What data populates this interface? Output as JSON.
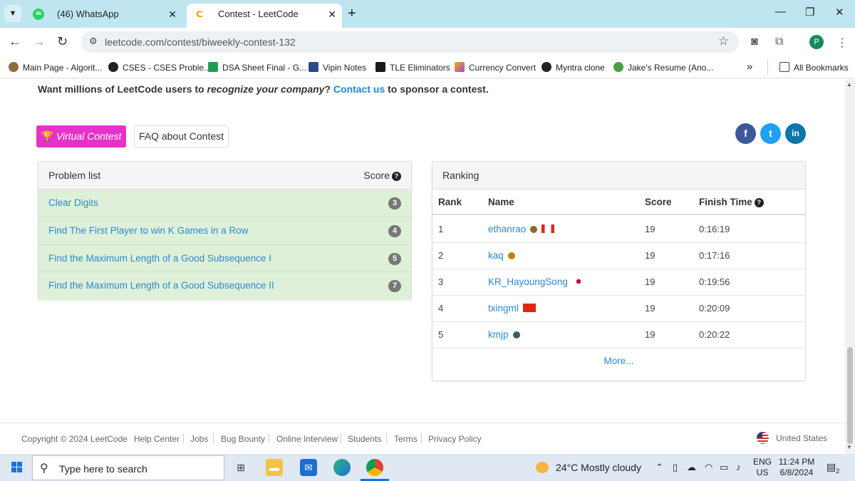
{
  "browser": {
    "tabs": [
      {
        "label": "(46) WhatsApp",
        "favicon": "whatsapp-icon",
        "badge": "46"
      },
      {
        "label": "Contest - LeetCode",
        "favicon": "leetcode-icon"
      }
    ],
    "url": "leetcode.com/contest/biweekly-contest-132",
    "profile_initial": "P",
    "bookmarks": [
      "Main Page - Algorit...",
      "CSES - CSES Proble...",
      "DSA Sheet Final - G...",
      "Vipin Notes",
      "TLE Eliminators",
      "Currency Convert",
      "Myntra clone",
      "Jake's Resume (Ano...",
      "All Bookmarks"
    ]
  },
  "page": {
    "sponsor": {
      "prefix": "Want millions of LeetCode users to ",
      "emph": "recognize your company",
      "mid": "? ",
      "link": "Contact us",
      "suffix": " to sponsor a contest."
    },
    "buttons": {
      "virtual": "Virtual Contest",
      "faq": "FAQ about Contest"
    },
    "social": [
      "f",
      "t",
      "in"
    ],
    "problems": {
      "header": "Problem list",
      "score_header": "Score",
      "items": [
        {
          "title": "Clear Digits",
          "score": "3"
        },
        {
          "title": "Find The First Player to win K Games in a Row",
          "score": "4"
        },
        {
          "title": "Find the Maximum Length of a Good Subsequence I",
          "score": "5"
        },
        {
          "title": "Find the Maximum Length of a Good Subsequence II",
          "score": "7"
        }
      ]
    },
    "ranking": {
      "title": "Ranking",
      "columns": [
        "Rank",
        "Name",
        "Score",
        "Finish Time"
      ],
      "rows": [
        {
          "rank": "1",
          "name": "ethanrao",
          "score": "19",
          "time": "0:16:19",
          "flag": "canada-flag"
        },
        {
          "rank": "2",
          "name": "kaq",
          "score": "19",
          "time": "0:17:16",
          "flag": ""
        },
        {
          "rank": "3",
          "name": "KR_HayoungSong",
          "score": "19",
          "time": "0:19:56",
          "flag": "korea-flag"
        },
        {
          "rank": "4",
          "name": "txingml",
          "score": "19",
          "time": "0:20:09",
          "flag": "china-flag"
        },
        {
          "rank": "5",
          "name": "kmjp",
          "score": "19",
          "time": "0:20:22",
          "flag": ""
        }
      ],
      "more": "More..."
    },
    "footer": {
      "copyright": "Copyright © 2024 LeetCode",
      "links": [
        "Help Center",
        "Jobs",
        "Bug Bounty",
        "Online Interview",
        "Students",
        "Terms",
        "Privacy Policy"
      ],
      "region": "United States"
    }
  },
  "taskbar": {
    "search_placeholder": "Type here to search",
    "weather": "24°C  Mostly cloudy",
    "lang": [
      "ENG",
      "US"
    ],
    "time": "11:24 PM",
    "date": "6/8/2024",
    "notifications": "2"
  },
  "colors": {
    "accent": "#e532c8",
    "link": "#2a8ad4",
    "row_bg": "#dff0d8"
  }
}
